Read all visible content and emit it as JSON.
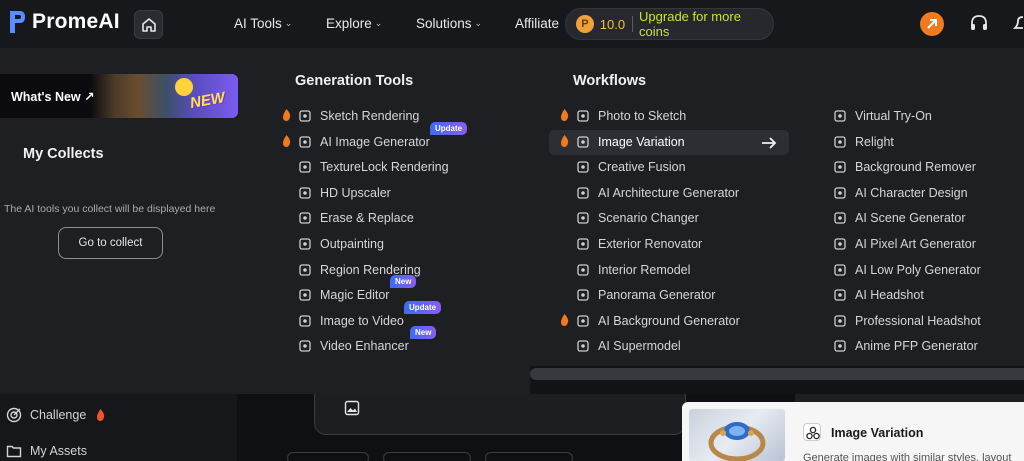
{
  "brand": {
    "name": "PromeAI"
  },
  "nav": {
    "items": [
      {
        "label": "AI Tools"
      },
      {
        "label": "Explore"
      },
      {
        "label": "Solutions"
      },
      {
        "label": "Affiliate"
      }
    ]
  },
  "coins": {
    "value": "10.0",
    "upgrade_label": "Upgrade for more coins",
    "icon_letter": "P"
  },
  "left_panel": {
    "whats_new_label": "What's New ↗",
    "new_badge": "NEW",
    "collects_title": "My Collects",
    "collects_desc": "The AI tools you collect will be displayed here",
    "goto_label": "Go to collect"
  },
  "menu": {
    "generation_title": "Generation Tools",
    "workflows_title": "Workflows",
    "generation_items": [
      {
        "label": "Sketch Rendering",
        "icon": "sketch-icon",
        "hot": true
      },
      {
        "label": "AI Image Generator",
        "icon": "image-icon",
        "hot": true,
        "badge": "Update"
      },
      {
        "label": "TextureLock Rendering",
        "icon": "wand-icon",
        "hot": false
      },
      {
        "label": "HD Upscaler",
        "icon": "upscale-icon",
        "hot": false
      },
      {
        "label": "Erase & Replace",
        "icon": "erase-icon",
        "hot": false
      },
      {
        "label": "Outpainting",
        "icon": "expand-icon",
        "hot": false
      },
      {
        "label": "Region Rendering",
        "icon": "brush-icon",
        "hot": false
      },
      {
        "label": "Magic Editor",
        "icon": "editor-icon",
        "hot": false,
        "badge": "New"
      },
      {
        "label": "Image to Video",
        "icon": "video-icon",
        "hot": false,
        "badge": "Update"
      },
      {
        "label": "Video Enhancer",
        "icon": "enhance-icon",
        "hot": false,
        "badge": "New"
      }
    ],
    "workflow_items_1": [
      {
        "label": "Photo to Sketch",
        "icon": "pen-icon",
        "hot": true
      },
      {
        "label": "Image Variation",
        "icon": "variation-icon",
        "hot": true,
        "active": true
      },
      {
        "label": "Creative Fusion",
        "icon": "fusion-icon",
        "hot": false
      },
      {
        "label": "AI Architecture Generator",
        "icon": "building-icon",
        "hot": false
      },
      {
        "label": "Scenario Changer",
        "icon": "grid-icon",
        "hot": false
      },
      {
        "label": "Exterior Renovator",
        "icon": "house-icon",
        "hot": false
      },
      {
        "label": "Interior Remodel",
        "icon": "interior-icon",
        "hot": false
      },
      {
        "label": "Panorama Generator",
        "icon": "panorama-icon",
        "hot": false
      },
      {
        "label": "AI Background Generator",
        "icon": "background-icon",
        "hot": true
      },
      {
        "label": "AI Supermodel",
        "icon": "model-icon",
        "hot": false
      }
    ],
    "workflow_items_2": [
      {
        "label": "Virtual Try-On",
        "icon": "shirt-icon"
      },
      {
        "label": "Relight",
        "icon": "light-icon"
      },
      {
        "label": "Background Remover",
        "icon": "remove-bg-icon"
      },
      {
        "label": "AI Character Design",
        "icon": "character-icon"
      },
      {
        "label": "AI Scene Generator",
        "icon": "scene-icon"
      },
      {
        "label": "AI Pixel Art Generator",
        "icon": "pixel-icon"
      },
      {
        "label": "AI Low Poly Generator",
        "icon": "cube-icon"
      },
      {
        "label": "AI Headshot",
        "icon": "headshot-icon"
      },
      {
        "label": "Professional Headshot",
        "icon": "person-icon"
      },
      {
        "label": "Anime PFP Generator",
        "icon": "anime-icon"
      }
    ]
  },
  "sidebar": {
    "items": [
      {
        "label": "Challenge",
        "icon": "target-icon"
      },
      {
        "label": "My Assets",
        "icon": "folder-icon"
      }
    ]
  },
  "tooltip": {
    "title": "Image Variation",
    "desc": "Generate images with similar styles, layout"
  },
  "colors": {
    "accent_lime": "#c9e52f",
    "coin": "#f1c04a",
    "hot": "#f07a1f",
    "badge_from": "#3b6cf5",
    "badge_to": "#8a5cf0"
  }
}
